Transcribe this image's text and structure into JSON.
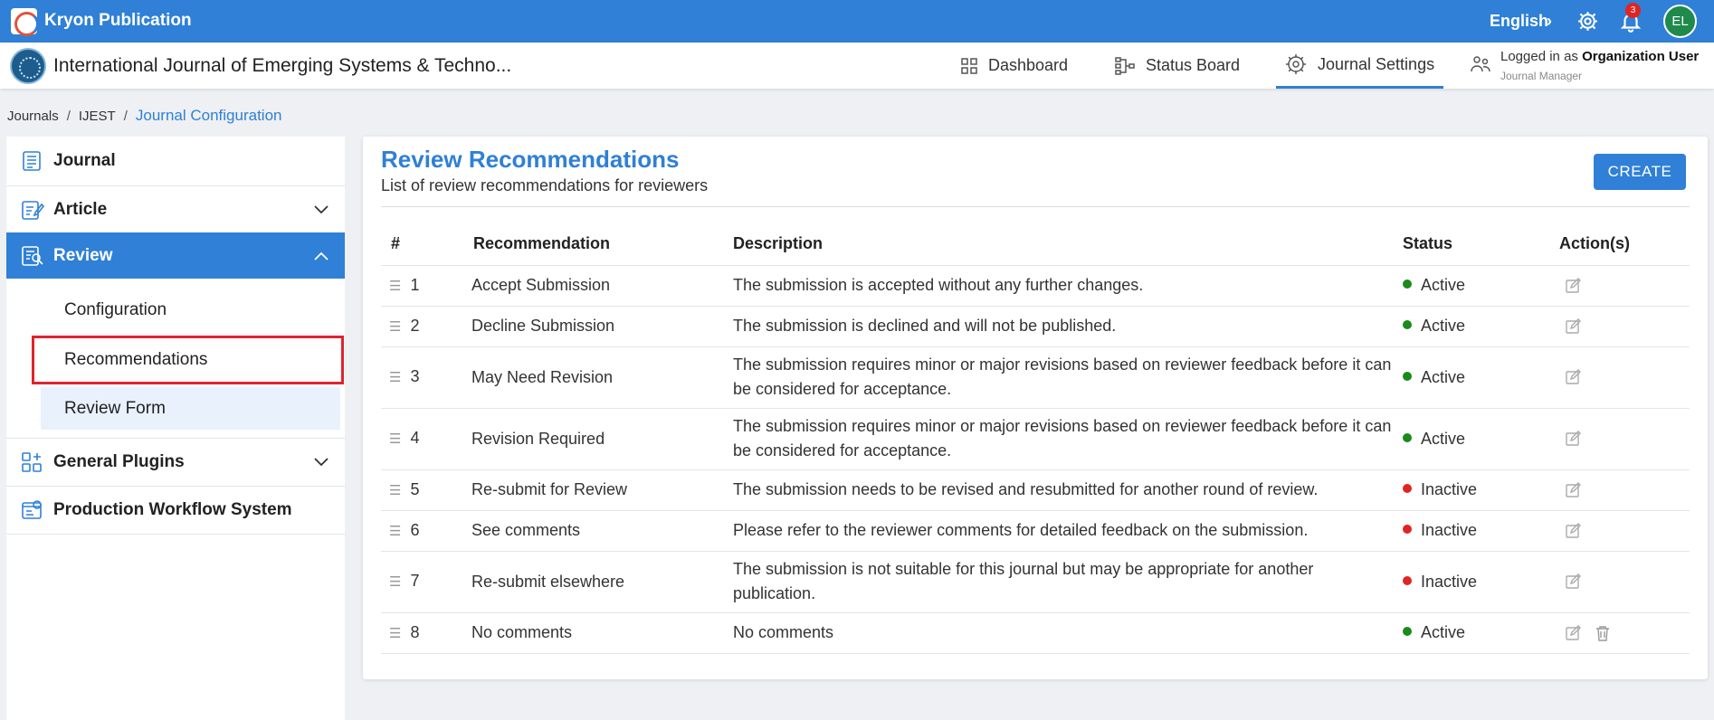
{
  "topbar": {
    "brand": "Kryon Publication",
    "language": "English",
    "notifications_count": "3",
    "avatar_initials": "EL"
  },
  "header": {
    "journal_title": "International Journal of Emerging Systems & Techno...",
    "nav": [
      {
        "label": "Dashboard",
        "icon": "dashboard-grid-icon"
      },
      {
        "label": "Status Board",
        "icon": "status-board-icon"
      },
      {
        "label": "Journal Settings",
        "icon": "settings-gear-icon",
        "active": true
      }
    ],
    "user": {
      "logged_prefix": "Logged in as ",
      "name": "Organization User",
      "role": "Journal Manager"
    }
  },
  "breadcrumb": {
    "items": [
      "Journals",
      "IJEST"
    ],
    "current": "Journal Configuration"
  },
  "sidebar": {
    "items": [
      {
        "label": "Journal",
        "icon": "journal-icon"
      },
      {
        "label": "Article",
        "icon": "article-edit-icon"
      },
      {
        "label": "Review",
        "icon": "review-icon",
        "active": true
      },
      {
        "label": "General Plugins",
        "icon": "plugins-icon"
      },
      {
        "label": "Production Workflow System",
        "icon": "workflow-icon"
      }
    ],
    "review_sub": [
      "Configuration",
      "Recommendations",
      "Review Form"
    ]
  },
  "main": {
    "title": "Review Recommendations",
    "subtitle": "List of review recommendations for reviewers",
    "create_label": "CREATE",
    "columns": [
      "#",
      "Recommendation",
      "Description",
      "Status",
      "Action(s)"
    ],
    "status_colors": {
      "Active": "#1a8a1a",
      "Inactive": "#e02424"
    },
    "rows": [
      {
        "num": "1",
        "name": "Accept Submission",
        "desc": "The submission is accepted without any further changes.",
        "status": "Active",
        "deletable": false
      },
      {
        "num": "2",
        "name": "Decline Submission",
        "desc": "The submission is declined and will not be published.",
        "status": "Active",
        "deletable": false
      },
      {
        "num": "3",
        "name": "May Need Revision",
        "desc": "The submission requires minor or major revisions based on reviewer feedback before it can be considered for acceptance.",
        "status": "Active",
        "deletable": false
      },
      {
        "num": "4",
        "name": "Revision Required",
        "desc": "The submission requires minor or major revisions based on reviewer feedback before it can be considered for acceptance.",
        "status": "Active",
        "deletable": false
      },
      {
        "num": "5",
        "name": "Re-submit for Review",
        "desc": "The submission needs to be revised and resubmitted for another round of review.",
        "status": "Inactive",
        "deletable": false
      },
      {
        "num": "6",
        "name": "See comments",
        "desc": "Please refer to the reviewer comments for detailed feedback on the submission.",
        "status": "Inactive",
        "deletable": false
      },
      {
        "num": "7",
        "name": "Re-submit elsewhere",
        "desc": "The submission is not suitable for this journal but may be appropriate for another publication.",
        "status": "Inactive",
        "deletable": false
      },
      {
        "num": "8",
        "name": "No comments",
        "desc": "No comments",
        "status": "Active",
        "deletable": true
      }
    ]
  }
}
